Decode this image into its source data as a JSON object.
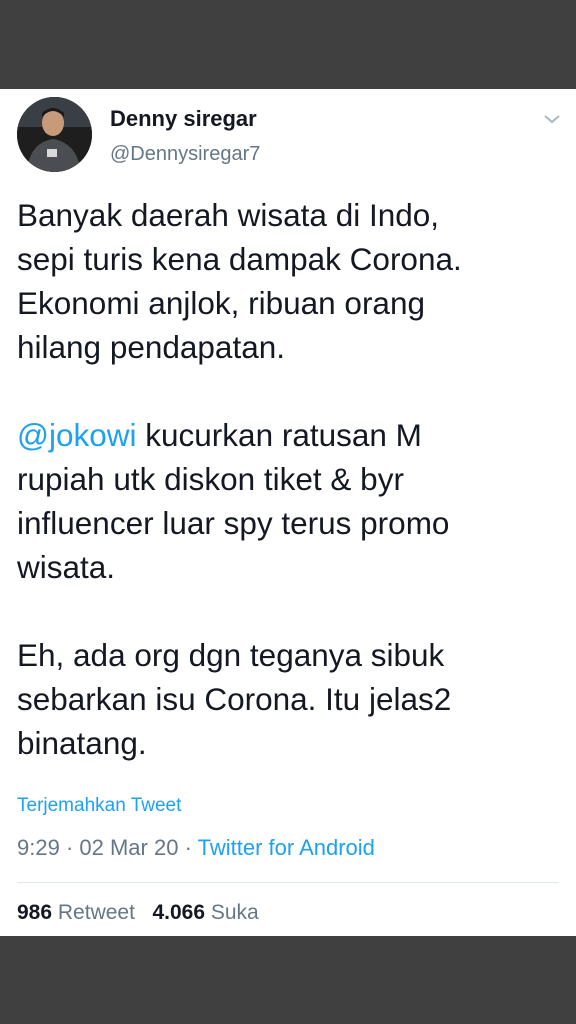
{
  "user": {
    "display_name": "Denny siregar",
    "handle": "@Dennysiregar7"
  },
  "tweet": {
    "paragraph1": {
      "lines": [
        "Banyak daerah wisata di Indo,",
        "sepi turis kena dampak Corona.",
        "Ekonomi anjlok, ribuan orang",
        "hilang pendapatan."
      ]
    },
    "paragraph2": {
      "mention": "@jokowi",
      "line1_rest": " kucurkan ratusan M",
      "lines": [
        "rupiah utk diskon tiket  & byr",
        "influencer luar spy terus promo",
        "wisata."
      ]
    },
    "paragraph3": {
      "lines": [
        "Eh, ada org dgn teganya sibuk",
        "sebarkan isu Corona. Itu jelas2",
        "binatang."
      ]
    },
    "translate_label": "Terjemahkan Tweet",
    "time": "9:29",
    "separator1": " · ",
    "date": "02 Mar 20",
    "separator2": " · ",
    "source": "Twitter for Android"
  },
  "stats": {
    "retweets_count": "986",
    "retweets_label": "Retweet",
    "likes_count": "4.066",
    "likes_label": "Suka"
  },
  "icons": {
    "menu": "chevron-down-icon",
    "avatar": "avatar"
  },
  "colors": {
    "link": "#1da1f2",
    "text": "#141823",
    "secondary": "#657786",
    "frame": "#404040"
  }
}
